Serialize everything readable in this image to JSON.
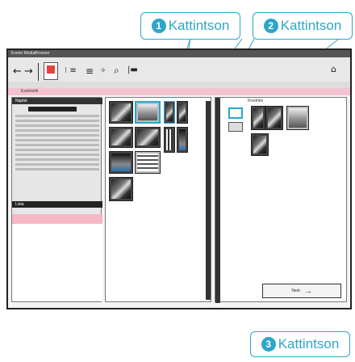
{
  "callouts": [
    {
      "num": "1",
      "label": "Kattintson"
    },
    {
      "num": "2",
      "label": "Kattintson"
    },
    {
      "num": "3",
      "label": "Kattintson"
    }
  ],
  "window": {
    "title": "Everio MediaBrowser",
    "pink_tab_label": "Eszközök"
  },
  "toolbar": {
    "back_icon": "arrow-left-icon",
    "forward_icon": "arrow-right-icon",
    "home_icon": "home-icon",
    "accent_red": "#e8423d"
  },
  "left_panel": {
    "calendar_header": "Naptár",
    "list_header": "Lista"
  },
  "right_panel": {
    "header": "Kivetítés"
  },
  "next_button": {
    "label": "Next",
    "arrow": "→"
  },
  "colors": {
    "callout": "#2ea6c9",
    "pinkbar": "#f3c3d1",
    "selection": "#27a6d1"
  }
}
